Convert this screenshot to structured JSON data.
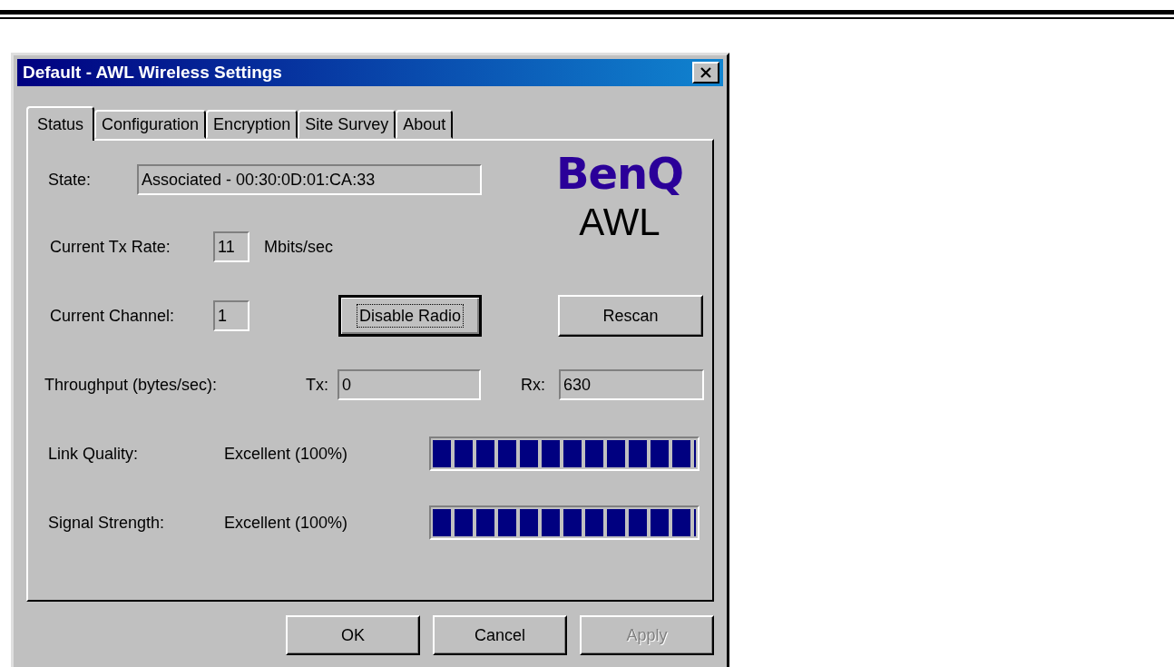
{
  "window": {
    "title": "Default - AWL Wireless Settings"
  },
  "tabs": [
    {
      "label": "Status",
      "selected": true
    },
    {
      "label": "Configuration",
      "selected": false
    },
    {
      "label": "Encryption",
      "selected": false
    },
    {
      "label": "Site Survey",
      "selected": false
    },
    {
      "label": "About",
      "selected": false
    }
  ],
  "logo": {
    "brand": "BenQ",
    "product": "AWL"
  },
  "state": {
    "label": "State:",
    "value": "Associated - 00:30:0D:01:CA:33"
  },
  "tx_rate": {
    "label": "Current Tx Rate:",
    "value": "11",
    "unit": "Mbits/sec"
  },
  "channel": {
    "label": "Current Channel:",
    "value": "1"
  },
  "radio_button": {
    "label": "Disable Radio",
    "focused": true
  },
  "rescan_button": {
    "label": "Rescan",
    "focused": false
  },
  "throughput": {
    "label": "Throughput (bytes/sec):",
    "tx_label": "Tx:",
    "tx_value": "0",
    "rx_label": "Rx:",
    "rx_value": "630"
  },
  "meters": [
    {
      "label": "Link Quality:",
      "reading": "Excellent (100%)",
      "level": 1
    },
    {
      "label": "Signal Strength:",
      "reading": "Excellent (100%)",
      "level": 1
    }
  ],
  "buttons": [
    {
      "label": "OK",
      "disabled": false
    },
    {
      "label": "Cancel",
      "disabled": false
    },
    {
      "label": "Apply",
      "disabled": true
    }
  ]
}
